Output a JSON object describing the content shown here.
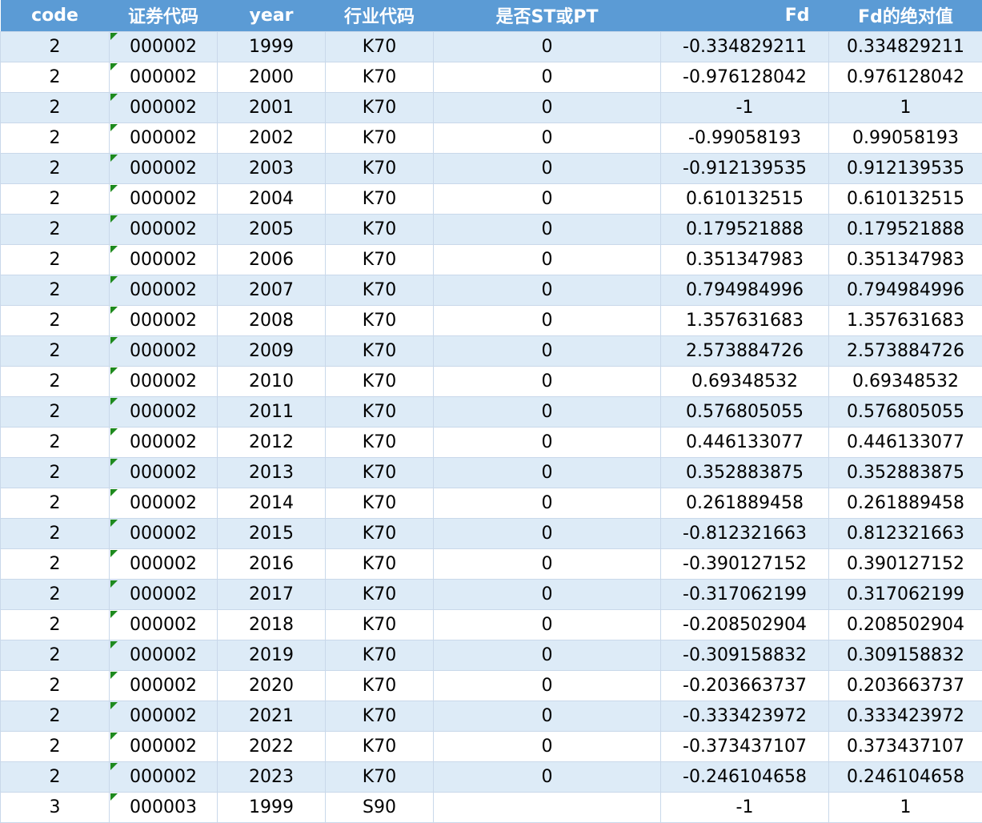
{
  "header": {
    "code": "code",
    "sec_code": "证券代码",
    "year": "year",
    "industry": "行业代码",
    "st_pt": "是否ST或PT",
    "fd": "Fd",
    "fd_abs": "Fd的绝对值"
  },
  "rows": [
    {
      "code": "2",
      "sec": "000002",
      "year": "1999",
      "ind": "K70",
      "st": "0",
      "fd": "-0.334829211",
      "abs": "0.334829211"
    },
    {
      "code": "2",
      "sec": "000002",
      "year": "2000",
      "ind": "K70",
      "st": "0",
      "fd": "-0.976128042",
      "abs": "0.976128042"
    },
    {
      "code": "2",
      "sec": "000002",
      "year": "2001",
      "ind": "K70",
      "st": "0",
      "fd": "-1",
      "abs": "1"
    },
    {
      "code": "2",
      "sec": "000002",
      "year": "2002",
      "ind": "K70",
      "st": "0",
      "fd": "-0.99058193",
      "abs": "0.99058193"
    },
    {
      "code": "2",
      "sec": "000002",
      "year": "2003",
      "ind": "K70",
      "st": "0",
      "fd": "-0.912139535",
      "abs": "0.912139535"
    },
    {
      "code": "2",
      "sec": "000002",
      "year": "2004",
      "ind": "K70",
      "st": "0",
      "fd": "0.610132515",
      "abs": "0.610132515"
    },
    {
      "code": "2",
      "sec": "000002",
      "year": "2005",
      "ind": "K70",
      "st": "0",
      "fd": "0.179521888",
      "abs": "0.179521888"
    },
    {
      "code": "2",
      "sec": "000002",
      "year": "2006",
      "ind": "K70",
      "st": "0",
      "fd": "0.351347983",
      "abs": "0.351347983"
    },
    {
      "code": "2",
      "sec": "000002",
      "year": "2007",
      "ind": "K70",
      "st": "0",
      "fd": "0.794984996",
      "abs": "0.794984996"
    },
    {
      "code": "2",
      "sec": "000002",
      "year": "2008",
      "ind": "K70",
      "st": "0",
      "fd": "1.357631683",
      "abs": "1.357631683"
    },
    {
      "code": "2",
      "sec": "000002",
      "year": "2009",
      "ind": "K70",
      "st": "0",
      "fd": "2.573884726",
      "abs": "2.573884726"
    },
    {
      "code": "2",
      "sec": "000002",
      "year": "2010",
      "ind": "K70",
      "st": "0",
      "fd": "0.69348532",
      "abs": "0.69348532"
    },
    {
      "code": "2",
      "sec": "000002",
      "year": "2011",
      "ind": "K70",
      "st": "0",
      "fd": "0.576805055",
      "abs": "0.576805055"
    },
    {
      "code": "2",
      "sec": "000002",
      "year": "2012",
      "ind": "K70",
      "st": "0",
      "fd": "0.446133077",
      "abs": "0.446133077"
    },
    {
      "code": "2",
      "sec": "000002",
      "year": "2013",
      "ind": "K70",
      "st": "0",
      "fd": "0.352883875",
      "abs": "0.352883875"
    },
    {
      "code": "2",
      "sec": "000002",
      "year": "2014",
      "ind": "K70",
      "st": "0",
      "fd": "0.261889458",
      "abs": "0.261889458"
    },
    {
      "code": "2",
      "sec": "000002",
      "year": "2015",
      "ind": "K70",
      "st": "0",
      "fd": "-0.812321663",
      "abs": "0.812321663"
    },
    {
      "code": "2",
      "sec": "000002",
      "year": "2016",
      "ind": "K70",
      "st": "0",
      "fd": "-0.390127152",
      "abs": "0.390127152"
    },
    {
      "code": "2",
      "sec": "000002",
      "year": "2017",
      "ind": "K70",
      "st": "0",
      "fd": "-0.317062199",
      "abs": "0.317062199"
    },
    {
      "code": "2",
      "sec": "000002",
      "year": "2018",
      "ind": "K70",
      "st": "0",
      "fd": "-0.208502904",
      "abs": "0.208502904"
    },
    {
      "code": "2",
      "sec": "000002",
      "year": "2019",
      "ind": "K70",
      "st": "0",
      "fd": "-0.309158832",
      "abs": "0.309158832"
    },
    {
      "code": "2",
      "sec": "000002",
      "year": "2020",
      "ind": "K70",
      "st": "0",
      "fd": "-0.203663737",
      "abs": "0.203663737"
    },
    {
      "code": "2",
      "sec": "000002",
      "year": "2021",
      "ind": "K70",
      "st": "0",
      "fd": "-0.333423972",
      "abs": "0.333423972"
    },
    {
      "code": "2",
      "sec": "000002",
      "year": "2022",
      "ind": "K70",
      "st": "0",
      "fd": "-0.373437107",
      "abs": "0.373437107"
    },
    {
      "code": "2",
      "sec": "000002",
      "year": "2023",
      "ind": "K70",
      "st": "0",
      "fd": "-0.246104658",
      "abs": "0.246104658"
    },
    {
      "code": "3",
      "sec": "000003",
      "year": "1999",
      "ind": "S90",
      "st": "",
      "fd": "-1",
      "abs": "1"
    }
  ],
  "colors": {
    "header_bg": "#5b9bd5",
    "header_text": "#ffffff",
    "band_row": "#ddebf7",
    "plain_row": "#ffffff",
    "text_marker": "#1e8a1e"
  }
}
